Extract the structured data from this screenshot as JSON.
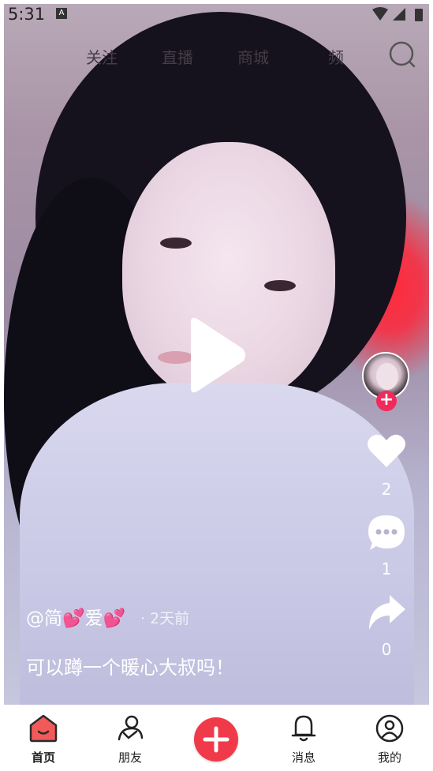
{
  "status_bar": {
    "time": "5:31",
    "notification_icon": "A"
  },
  "top_tabs": {
    "items": [
      {
        "label": "关注"
      },
      {
        "label": "直播"
      },
      {
        "label": "商城"
      },
      {
        "label": "频"
      }
    ],
    "search_icon": "search-icon"
  },
  "video": {
    "author": "@简💕爱💕",
    "time_ago": "· 2天前",
    "description": "可以蹲一个暖心大叔吗！",
    "paused": true
  },
  "actions": {
    "follow_label": "+",
    "likes": "2",
    "comments": "1",
    "shares": "0"
  },
  "bottom_nav": {
    "items": [
      {
        "label": "首页",
        "icon": "home-icon",
        "active": true
      },
      {
        "label": "朋友",
        "icon": "friends-icon"
      },
      {
        "label": "",
        "icon": "plus-icon"
      },
      {
        "label": "消息",
        "icon": "message-bell-icon"
      },
      {
        "label": "我的",
        "icon": "profile-icon"
      }
    ]
  },
  "colors": {
    "accent": "#f03a4a",
    "follow": "#f02a5a"
  }
}
